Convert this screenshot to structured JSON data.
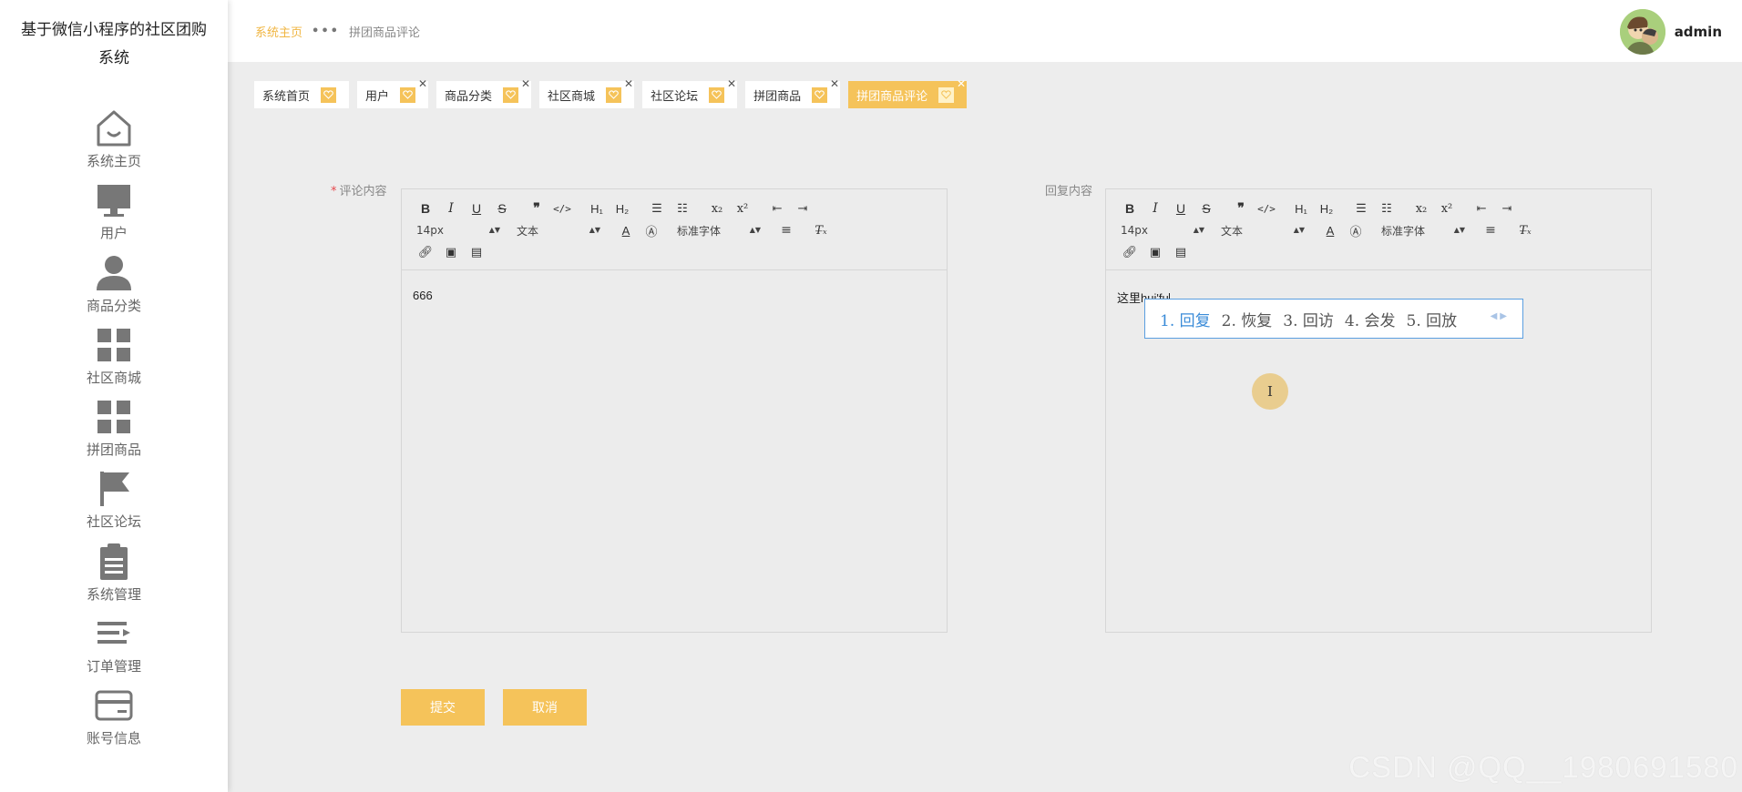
{
  "app": {
    "title": "基于微信小程序的社区团购系统"
  },
  "sidebar": {
    "items": [
      {
        "label": "系统主页",
        "icon": "house-icon"
      },
      {
        "label": "用户",
        "icon": "monitor-icon"
      },
      {
        "label": "商品分类",
        "icon": "person-icon"
      },
      {
        "label": "社区商城",
        "icon": "grid-icon"
      },
      {
        "label": "拼团商品",
        "icon": "grid-icon"
      },
      {
        "label": "社区论坛",
        "icon": "flag-icon"
      },
      {
        "label": "系统管理",
        "icon": "clipboard-icon"
      },
      {
        "label": "订单管理",
        "icon": "list-icon"
      },
      {
        "label": "账号信息",
        "icon": "card-icon"
      }
    ]
  },
  "header": {
    "breadcrumb_home": "系统主页",
    "breadcrumb_sep": "•••",
    "breadcrumb_current": "拼团商品评论",
    "username": "admin"
  },
  "tags": [
    {
      "label": "系统首页",
      "closable": false
    },
    {
      "label": "用户",
      "closable": true
    },
    {
      "label": "商品分类",
      "closable": true
    },
    {
      "label": "社区商城",
      "closable": true
    },
    {
      "label": "社区论坛",
      "closable": true
    },
    {
      "label": "拼团商品",
      "closable": true
    },
    {
      "label": "拼团商品评论",
      "closable": true,
      "active": true
    }
  ],
  "form": {
    "comment_label": "评论内容",
    "comment_required_mark": "*",
    "comment_value": "666",
    "reply_label": "回复内容",
    "reply_value": "这里hui'fu",
    "submit": "提交",
    "cancel": "取消"
  },
  "editor_toolbar": {
    "size": "14px",
    "header": "文本",
    "font": "标准字体"
  },
  "ime": {
    "candidates": [
      "1. 回复",
      "2. 恢复",
      "3. 回访",
      "4. 会发",
      "5. 回放"
    ]
  },
  "watermark": "CSDN @QQ__1980691580",
  "colors": {
    "accent": "#f5c35a",
    "breadcrumb_home": "#f0b643",
    "required": "#e6484c",
    "ime_border": "#5a9ee0"
  }
}
